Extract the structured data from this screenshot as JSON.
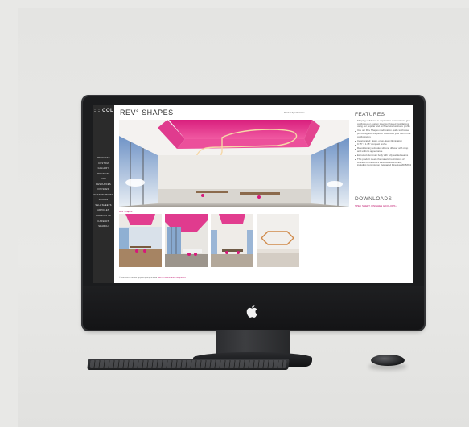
{
  "site": {
    "logo": "::::COL",
    "nav_items": [
      "PRODUCTS",
      "CUSTOM",
      "GALLERY",
      "PROJECTS",
      "BIOS",
      "RESOURCES",
      "FINISHES",
      "SUSTAINABILITY",
      "DESIGN",
      "SELL SHEETS",
      "ARTICLES",
      "CONTACT US",
      "CAREERS",
      "SEARCH"
    ]
  },
  "page": {
    "title": "REV° SHAPES",
    "top_link": "Product Specifications",
    "thumbnail_caption": "Rev Shapes",
    "footer_text": "© 2023 this is the site. Applied lighting is a site",
    "footer_link": "See the full info about this product."
  },
  "features": {
    "title": "FEATURES",
    "items": [
      "Shaping of fixtures to expand the standard and give configured or custom laser configured installations using our popular and architectural luminaire profile",
      "Use our Rev Shapes modification guide to choose pre-configured shapes or customize your own in the configuration.",
      "Incorporated: down, or up-down illumination",
      "0.75\" x 1.75\" compact profile",
      "Revolutionary extruded silicone diffuser with crisp and uniform appearance",
      "Extruded aluminum body with fully welded seams",
      "This product meets the material restrictions of Article 4 of the RoHS Directive 2011/65/EU, including Commission Delegated Directive 2015/863"
    ]
  },
  "downloads": {
    "title": "DOWNLOADS",
    "link": "SPEC SHEET, FINISHES & COLORS ›"
  },
  "device": {
    "apple_logo": ""
  },
  "colors": {
    "accent": "#c0186e",
    "ceiling_pink": "#e8348c",
    "nav_bg": "#2b2b2b",
    "bezel": "#1b1c1e"
  }
}
